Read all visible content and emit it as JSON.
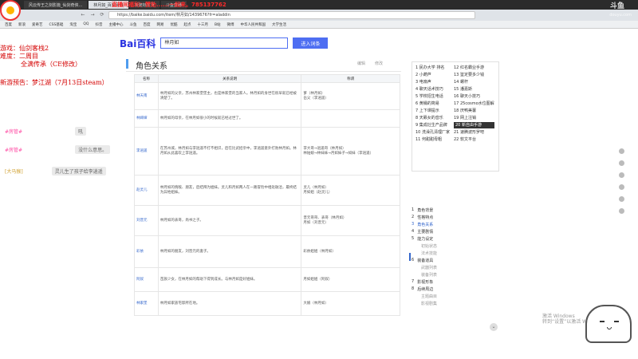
{
  "browser": {
    "tabs": [
      "风云传王之剑影篇_仙剑奇侠...",
      "林月如_百度百科",
      "新建标签页",
      "斗鱼直播"
    ],
    "url": "https://baike.baidu.com/item/林月如/1439676?fr=aladdin",
    "marquee": "直播间福利：赞助......一起来。785137762",
    "nav": [
      "←",
      "→",
      "⟳"
    ],
    "bookmarks": [
      "百度",
      "新浪",
      "爱奇艺",
      "CSS基础",
      "淘宝",
      "QQ",
      "抖音",
      "主播中心",
      "斗鱼",
      "百度",
      "网易",
      "优酷",
      "起点",
      "十三月",
      "B站",
      "微博",
      "中华人民共和国",
      "大学生活",
      "音乐",
      "智慧树"
    ]
  },
  "watermark": {
    "brand": "斗鱼",
    "sub": "douyu.com"
  },
  "stream_overlay": {
    "game_label": "游戏：仙剑客栈2",
    "difficulty_label": "难度：二周目",
    "difficulty_extra": "全满传承（CE修改）",
    "announce": "新游预告：梦江湖（7月13日steam）",
    "chat": [
      {
        "user": "#房管#",
        "text": "吼"
      },
      {
        "user": "#房管#",
        "text": "没什么意思。"
      },
      {
        "user": "[大马猴]",
        "text": "灵儿生了孩子给李逍遥"
      }
    ]
  },
  "baike": {
    "logo": "Bai百科",
    "search_value": "林月如",
    "search_button": "进入词条",
    "section_title": "角色关系",
    "section_tools": [
      "编辑",
      "修改"
    ],
    "table": {
      "headers": [
        "名称",
        "关系说明",
        "称谓"
      ],
      "rows": [
        {
          "name": "林天南",
          "desc": "林月如的父亲，苏州林家堡堡主，也是林家堡的当家人。林月如的身世在很早就已经被清楚了。",
          "rel": "爹（林月如）\n岳父（李逍遥）"
        },
        {
          "name": "林婶婶",
          "desc": "林月如的母亲，在林月如很小的时候就已经过世了。",
          "rel": ""
        },
        {
          "name": "李逍遥",
          "desc": "在苏州城，林月如与李逍遥不打不相识，后在比武招亲中，李逍遥意外打败林月如。林月如从此喜欢上李逍遥。",
          "rel": "李大哥→逍遥哥（林月如）\n林姑娘→林妹妹→月如妹子→如妹（李逍遥）"
        },
        {
          "name": "赵灵儿",
          "desc": "林月如的情敌、朋友，后结拜为姐妹。灵儿和月如两人在一路冒险中相处融洽，最终结为异姓姐妹。",
          "rel": "灵儿（林月如）\n月如姐（赵灵儿）"
        },
        {
          "name": "刘晋元",
          "desc": "林月如的表哥，尚书之子。",
          "rel": "晋元哥哥、表哥（林月如）\n月如（刘晋元）"
        },
        {
          "name": "彩依",
          "desc": "林月如的朋友，刘晋元的妻子。",
          "rel": "彩依姐姐（林月如）"
        },
        {
          "name": "阿奴",
          "desc": "苗族少女，在林月如的帮助下得到成长。与林月如是好姐妹。",
          "rel": "月如姐姐（阿奴）"
        },
        {
          "name": "林家堡",
          "desc": "林月如家族宅邸所在地。",
          "rel": "大娘（林月如）"
        }
      ]
    },
    "toc": [
      [
        "1 民办大学 排名",
        "2 小葫芦",
        "3 电扇声",
        "4 聊天话术技巧",
        "5 学校招生电话",
        "6 黄桶的简易",
        "7 上下课提示",
        "8 天籁女的音乐",
        "9 集成灶生产品牌",
        "10 洗澡孔清理厂家",
        "11 何甜甜母粗"
      ],
      [
        "12 红名霸业手游",
        "13 鉴定要多少钱",
        "14 螺杆",
        "15 潘嘉斯",
        "16 聊天小技巧",
        "17 25cosmo水位图解",
        "18 厌鸭美薯",
        "19 网上注销",
        "20 新自由手游",
        "21 速腾波形罗吧",
        "22 软文平台"
      ]
    ],
    "toc_highlight": "20 新自由手游",
    "outline": [
      {
        "num": "1",
        "label": "角色背景",
        "sub": false
      },
      {
        "num": "2",
        "label": "性格特点",
        "sub": false
      },
      {
        "num": "3",
        "label": "角色关系",
        "sub": false,
        "active": true
      },
      {
        "num": "4",
        "label": "主要剧情",
        "sub": false
      },
      {
        "num": "5",
        "label": "能力设定",
        "sub": false
      },
      {
        "num": "",
        "label": "初始状态",
        "sub": true
      },
      {
        "num": "",
        "label": "法术技能",
        "sub": true
      },
      {
        "num": "6",
        "label": "装备道具",
        "sub": false
      },
      {
        "num": "",
        "label": "武器列表",
        "sub": true
      },
      {
        "num": "",
        "label": "装备列表",
        "sub": true
      },
      {
        "num": "7",
        "label": "影视形象",
        "sub": false
      },
      {
        "num": "8",
        "label": "后续周边",
        "sub": false
      },
      {
        "num": "",
        "label": "主题曲目",
        "sub": true
      },
      {
        "num": "",
        "label": "影视剧集",
        "sub": true
      }
    ]
  },
  "windows": {
    "activate_title": "激活 Windows",
    "activate_sub": "转到“设置”以激活 Windows。"
  }
}
